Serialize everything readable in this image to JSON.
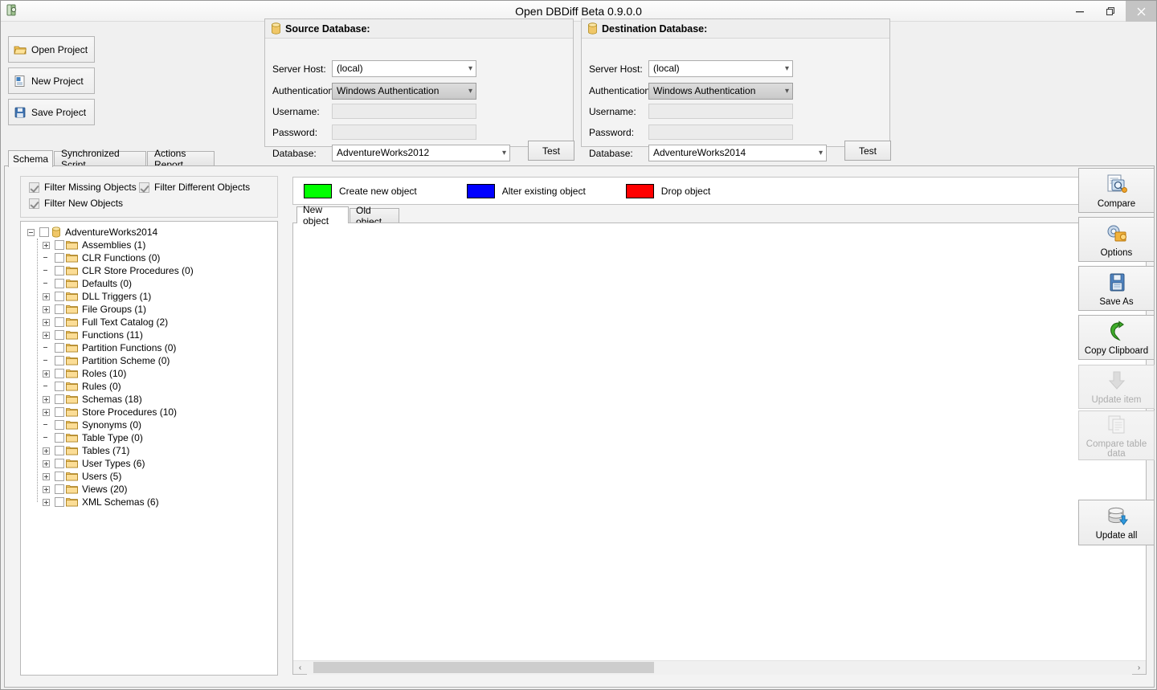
{
  "window": {
    "title": "Open DBDiff Beta 0.9.0.0",
    "app_icon": "database-app-icon",
    "minimize_label": "Minimize",
    "maximize_label": "Restore",
    "close_label": "Close"
  },
  "project_buttons": [
    {
      "label": "Open Project",
      "icon": "open-folder-icon"
    },
    {
      "label": "New Project",
      "icon": "new-document-icon"
    },
    {
      "label": "Save Project",
      "icon": "floppy-save-icon"
    }
  ],
  "source_db": {
    "title": "Source Database:",
    "icon": "database-cylinder-icon",
    "labels": {
      "server_host": "Server Host:",
      "authentication": "Authentication",
      "username": "Username:",
      "password": "Password:",
      "database": "Database:"
    },
    "server_host_value": "(local)",
    "authentication_value": "Windows Authentication",
    "username_value": "",
    "password_value": "",
    "database_value": "AdventureWorks2012",
    "test_label": "Test"
  },
  "destination_db": {
    "title": "Destination Database:",
    "icon": "database-cylinder-icon",
    "labels": {
      "server_host": "Server Host:",
      "authentication": "Authentication",
      "username": "Username:",
      "password": "Password:",
      "database": "Database:"
    },
    "server_host_value": "(local)",
    "authentication_value": "Windows Authentication",
    "username_value": "",
    "password_value": "",
    "database_value": "AdventureWorks2014",
    "test_label": "Test"
  },
  "main_tabs": [
    {
      "label": "Schema",
      "selected": true
    },
    {
      "label": "Synchronized Script",
      "selected": false
    },
    {
      "label": "Actions Report",
      "selected": false
    }
  ],
  "filters": [
    {
      "label": "Filter Missing Objects",
      "checked": true
    },
    {
      "label": "Filter Different Objects",
      "checked": true
    },
    {
      "label": "Filter New Objects",
      "checked": true
    }
  ],
  "tree": {
    "root": {
      "label": "AdventureWorks2014",
      "icon": "database-cylinder-icon",
      "expander": "minus",
      "checked": false
    },
    "nodes": [
      {
        "label": "Assemblies (1)",
        "expander": "plus"
      },
      {
        "label": "CLR Functions (0)",
        "expander": "none"
      },
      {
        "label": "CLR Store Procedures (0)",
        "expander": "none"
      },
      {
        "label": "Defaults (0)",
        "expander": "none"
      },
      {
        "label": "DLL Triggers (1)",
        "expander": "plus"
      },
      {
        "label": "File Groups (1)",
        "expander": "plus"
      },
      {
        "label": "Full Text Catalog (2)",
        "expander": "plus"
      },
      {
        "label": "Functions (11)",
        "expander": "plus"
      },
      {
        "label": "Partition Functions (0)",
        "expander": "none"
      },
      {
        "label": "Partition Scheme (0)",
        "expander": "none"
      },
      {
        "label": "Roles (10)",
        "expander": "plus"
      },
      {
        "label": "Rules (0)",
        "expander": "none"
      },
      {
        "label": "Schemas (18)",
        "expander": "plus"
      },
      {
        "label": "Store Procedures (10)",
        "expander": "plus"
      },
      {
        "label": "Synonyms (0)",
        "expander": "none"
      },
      {
        "label": "Table Type (0)",
        "expander": "none"
      },
      {
        "label": "Tables (71)",
        "expander": "plus"
      },
      {
        "label": "User Types (6)",
        "expander": "plus"
      },
      {
        "label": "Users (5)",
        "expander": "plus"
      },
      {
        "label": "Views (20)",
        "expander": "plus"
      },
      {
        "label": "XML Schemas (6)",
        "expander": "plus"
      }
    ]
  },
  "legend": [
    {
      "label": "Create new object",
      "color": "#00FF00"
    },
    {
      "label": "Alter existing object",
      "color": "#0000FF"
    },
    {
      "label": "Drop object",
      "color": "#FF0000"
    }
  ],
  "object_tabs": [
    {
      "label": "New object",
      "selected": true
    },
    {
      "label": "Old object",
      "selected": false
    }
  ],
  "content": {
    "text": "",
    "scroll_left_arrow": "‹",
    "scroll_right_arrow": "›"
  },
  "action_buttons": [
    {
      "label": "Compare",
      "icon": "compare-documents-icon",
      "disabled": false
    },
    {
      "label": "Options",
      "icon": "options-gear-icon",
      "disabled": false
    },
    {
      "label": "Save As",
      "icon": "floppy-save-icon",
      "disabled": false
    },
    {
      "label": "Copy Clipboard",
      "icon": "copy-clipboard-icon",
      "disabled": false
    },
    {
      "label": "Update item",
      "icon": "down-arrow-icon",
      "disabled": true
    },
    {
      "label": "Compare table data",
      "icon": "compare-table-icon",
      "disabled": true
    },
    {
      "label": "Update all",
      "icon": "database-update-icon",
      "disabled": false
    }
  ]
}
